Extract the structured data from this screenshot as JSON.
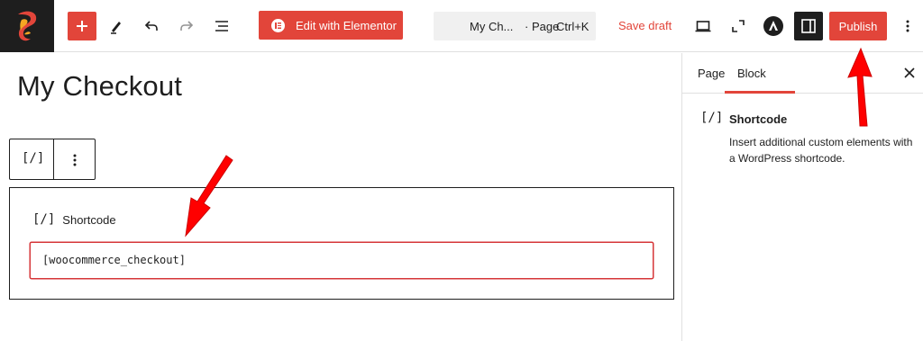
{
  "toolbar": {
    "elementor_label": "Edit with Elementor",
    "doc_title": "My Ch...",
    "doc_kind": "· Page",
    "shortcut": "Ctrl+K",
    "save_draft": "Save draft",
    "publish": "Publish"
  },
  "editor": {
    "page_title": "My Checkout",
    "block_icon": "[/]",
    "shortcode_label": "Shortcode",
    "shortcode_value": "[woocommerce_checkout]"
  },
  "sidebar": {
    "tabs": [
      {
        "label": "Page"
      },
      {
        "label": "Block"
      }
    ],
    "block": {
      "icon": "[/]",
      "name": "Shortcode",
      "description": "Insert additional custom elements with a WordPress shortcode."
    }
  },
  "colors": {
    "accent": "#e2453a",
    "dark": "#1e1e1e",
    "annotation_arrow": "#ff0000"
  }
}
